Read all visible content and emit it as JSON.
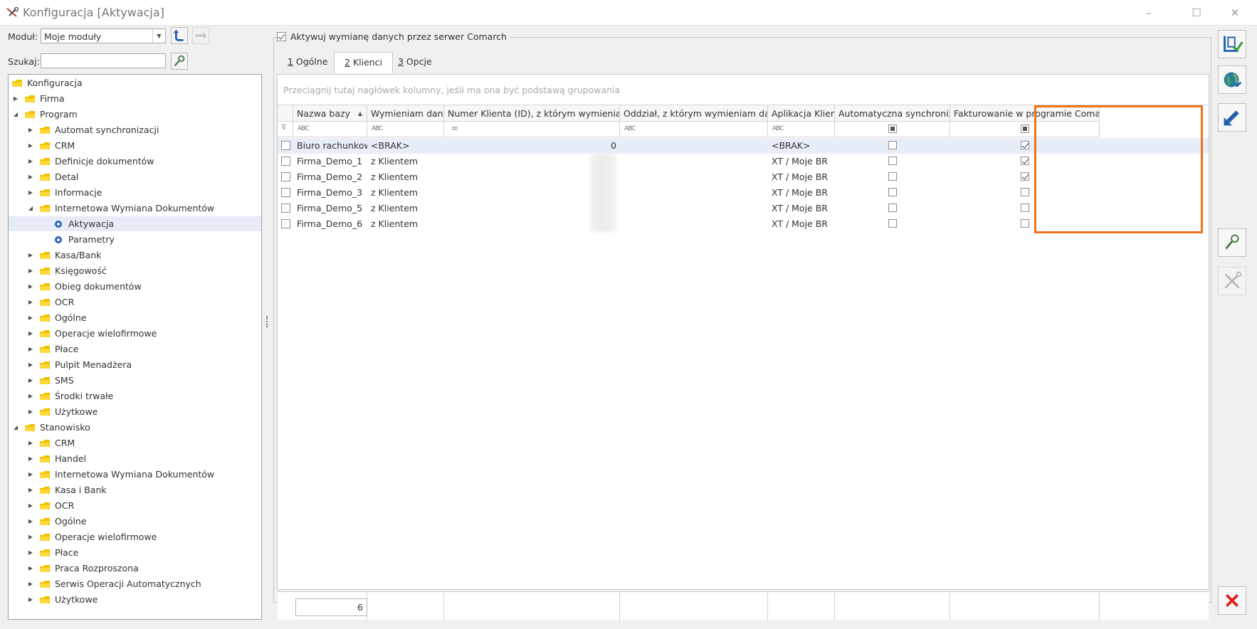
{
  "window": {
    "title": "Konfiguracja [Aktywacja]",
    "minimize": "–",
    "maximize": "☐",
    "close": "✕"
  },
  "module": {
    "label": "Moduł:",
    "value": "Moje moduły"
  },
  "search": {
    "label": "Szukaj:",
    "value": ""
  },
  "tree": [
    {
      "label": "Konfiguracja",
      "level": 0,
      "expander": ""
    },
    {
      "label": "Firma",
      "level": 1,
      "expander": "collapsed"
    },
    {
      "label": "Program",
      "level": 1,
      "expander": "expanded"
    },
    {
      "label": "Automat synchronizacji",
      "level": 2,
      "expander": "collapsed"
    },
    {
      "label": "CRM",
      "level": 2,
      "expander": "collapsed"
    },
    {
      "label": "Definicje dokumentów",
      "level": 2,
      "expander": "collapsed"
    },
    {
      "label": "Detal",
      "level": 2,
      "expander": "collapsed"
    },
    {
      "label": "Informacje",
      "level": 2,
      "expander": "collapsed"
    },
    {
      "label": "Internetowa Wymiana Dokumentów",
      "level": 2,
      "expander": "expanded"
    },
    {
      "label": "Aktywacja",
      "level": 3,
      "expander": "",
      "leaf": true,
      "selected": true
    },
    {
      "label": "Parametry",
      "level": 3,
      "expander": "",
      "leaf": true
    },
    {
      "label": "Kasa/Bank",
      "level": 2,
      "expander": "collapsed"
    },
    {
      "label": "Księgowość",
      "level": 2,
      "expander": "collapsed"
    },
    {
      "label": "Obieg dokumentów",
      "level": 2,
      "expander": "collapsed"
    },
    {
      "label": "OCR",
      "level": 2,
      "expander": "collapsed"
    },
    {
      "label": "Ogólne",
      "level": 2,
      "expander": "collapsed"
    },
    {
      "label": "Operacje wielofirmowe",
      "level": 2,
      "expander": "collapsed"
    },
    {
      "label": "Płace",
      "level": 2,
      "expander": "collapsed"
    },
    {
      "label": "Pulpit Menadżera",
      "level": 2,
      "expander": "collapsed"
    },
    {
      "label": "SMS",
      "level": 2,
      "expander": "collapsed"
    },
    {
      "label": "Środki trwałe",
      "level": 2,
      "expander": "collapsed"
    },
    {
      "label": "Użytkowe",
      "level": 2,
      "expander": "collapsed"
    },
    {
      "label": "Stanowisko",
      "level": 1,
      "expander": "expanded"
    },
    {
      "label": "CRM",
      "level": 2,
      "expander": "collapsed"
    },
    {
      "label": "Handel",
      "level": 2,
      "expander": "collapsed"
    },
    {
      "label": "Internetowa Wymiana Dokumentów",
      "level": 2,
      "expander": "collapsed"
    },
    {
      "label": "Kasa i Bank",
      "level": 2,
      "expander": "collapsed"
    },
    {
      "label": "OCR",
      "level": 2,
      "expander": "collapsed"
    },
    {
      "label": "Ogólne",
      "level": 2,
      "expander": "collapsed"
    },
    {
      "label": "Operacje wielofirmowe",
      "level": 2,
      "expander": "collapsed"
    },
    {
      "label": "Płace",
      "level": 2,
      "expander": "collapsed"
    },
    {
      "label": "Praca Rozproszona",
      "level": 2,
      "expander": "collapsed"
    },
    {
      "label": "Serwis Operacji Automatycznych",
      "level": 2,
      "expander": "collapsed"
    },
    {
      "label": "Użytkowe",
      "level": 2,
      "expander": "collapsed"
    }
  ],
  "activate": {
    "label": "Aktywuj wymianę danych przez serwer Comarch",
    "checked": true
  },
  "tabs": [
    {
      "key": "1",
      "label": " Ogólne",
      "active": false
    },
    {
      "key": "2",
      "label": " Klienci",
      "active": true
    },
    {
      "key": "3",
      "label": " Opcje",
      "active": false
    }
  ],
  "grid": {
    "group_hint": "Przeciągnij tutaj nagłówek kolumny, jeśli ma ona być podstawą grupowania",
    "columns": [
      "Nazwa bazy",
      "Wymieniam dane",
      "Numer Klienta (ID), z którym wymieniam dane",
      "Oddział, z którym wymieniam dane",
      "Aplikacja Klienta",
      "Automatyczna synchronizacja",
      "Fakturowanie w programie Comarch"
    ],
    "rows": [
      {
        "name": "Biuro rachunkowe",
        "exchange": "<BRAK>",
        "client_id": "0",
        "branch": "",
        "app": "<BRAK>",
        "auto_sync": false,
        "invoicing": true
      },
      {
        "name": "Firma_Demo_1",
        "exchange": "z Klientem",
        "client_id": "",
        "branch": "",
        "app": "XT / Moje BR",
        "auto_sync": false,
        "invoicing": true
      },
      {
        "name": "Firma_Demo_2",
        "exchange": "z Klientem",
        "client_id": "",
        "branch": "",
        "app": "XT / Moje BR",
        "auto_sync": false,
        "invoicing": true
      },
      {
        "name": "Firma_Demo_3",
        "exchange": "z Klientem",
        "client_id": "",
        "branch": "",
        "app": "XT / Moje BR",
        "auto_sync": false,
        "invoicing": false
      },
      {
        "name": "Firma_Demo_5",
        "exchange": "z Klientem",
        "client_id": "",
        "branch": "",
        "app": "XT / Moje BR",
        "auto_sync": false,
        "invoicing": false
      },
      {
        "name": "Firma_Demo_6",
        "exchange": "z Klientem",
        "client_id": "",
        "branch": "",
        "app": "XT / Moje BR",
        "auto_sync": false,
        "invoicing": false
      }
    ],
    "footer_count": "6"
  },
  "colors": {
    "highlight": "#f0721e",
    "folder": "#f2c200",
    "accent_blue": "#1f5fae",
    "close_red": "#e0201e"
  }
}
